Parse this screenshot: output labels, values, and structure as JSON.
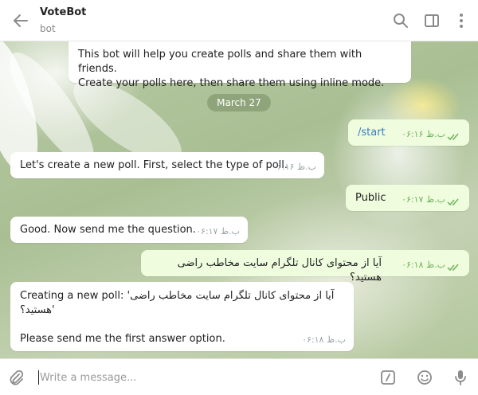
{
  "header": {
    "title": "VoteBot",
    "subtitle": "bot"
  },
  "date_separator": "March 27",
  "messages": [
    {
      "dir": "in",
      "lines": [
        "This bot will help you create polls and share them with friends.",
        "Create your polls here, then share them using inline mode."
      ]
    },
    {
      "dir": "out",
      "text": "/start",
      "time": "۰۶:۱۶ ب.ظ"
    },
    {
      "dir": "in",
      "text": "Let's create a new poll. First, select the type of poll.",
      "time": "۰۶:۱۶ ب.ظ"
    },
    {
      "dir": "out",
      "text": "Public",
      "time": "۰۶:۱۷ ب.ظ"
    },
    {
      "dir": "in",
      "text": "Good. Now send me the question.",
      "time": "۰۶:۱۷ ب.ظ"
    },
    {
      "dir": "out",
      "text": "آیا از محتوای کانال تلگرام سایت مخاطب راضی هستید؟",
      "time": "۰۶:۱۸ ب.ظ"
    },
    {
      "dir": "in",
      "line1": "Creating a new poll: 'آیا از محتوای کانال تلگرام سایت مخاطب راضی",
      "line2": "هستید؟'",
      "line3": "Please send me the first answer option.",
      "time": "۰۶:۱۸ ب.ظ"
    }
  ],
  "composer": {
    "placeholder": "Write a message..."
  },
  "colors": {
    "outgoing_bubble": "#effdde",
    "incoming_bubble": "#ffffff",
    "read_check": "#6fb05a"
  },
  "icons": [
    "back-arrow-icon",
    "search-icon",
    "sidebar-toggle-icon",
    "more-vertical-icon",
    "attach-icon",
    "bot-command-icon",
    "emoji-icon",
    "microphone-icon"
  ]
}
